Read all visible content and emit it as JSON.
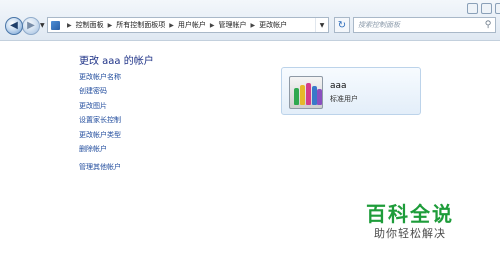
{
  "address_bar": {
    "breadcrumbs": [
      "控制面板",
      "所有控制面板项",
      "用户帐户",
      "管理帐户",
      "更改帐户"
    ],
    "search_placeholder": "搜索控制面板"
  },
  "main": {
    "title": "更改 aaa 的帐户",
    "tasks": [
      "更改帐户名称",
      "创建密码",
      "更改图片",
      "设置家长控制",
      "更改帐户类型",
      "删除帐户"
    ],
    "other_link": "管理其他帐户"
  },
  "account": {
    "name": "aaa",
    "type": "标准用户"
  },
  "watermark": {
    "main": "百科全说",
    "sub": "助你轻松解决"
  },
  "icons": {
    "back": "back-arrow-icon",
    "forward": "forward-arrow-icon",
    "control_panel": "control-panel-icon",
    "refresh": "refresh-icon",
    "search": "search-icon",
    "avatar": "crayons-icon"
  },
  "colors": {
    "link": "#1e4a9c",
    "title": "#1e3287",
    "watermark": "#1e9c3a"
  }
}
